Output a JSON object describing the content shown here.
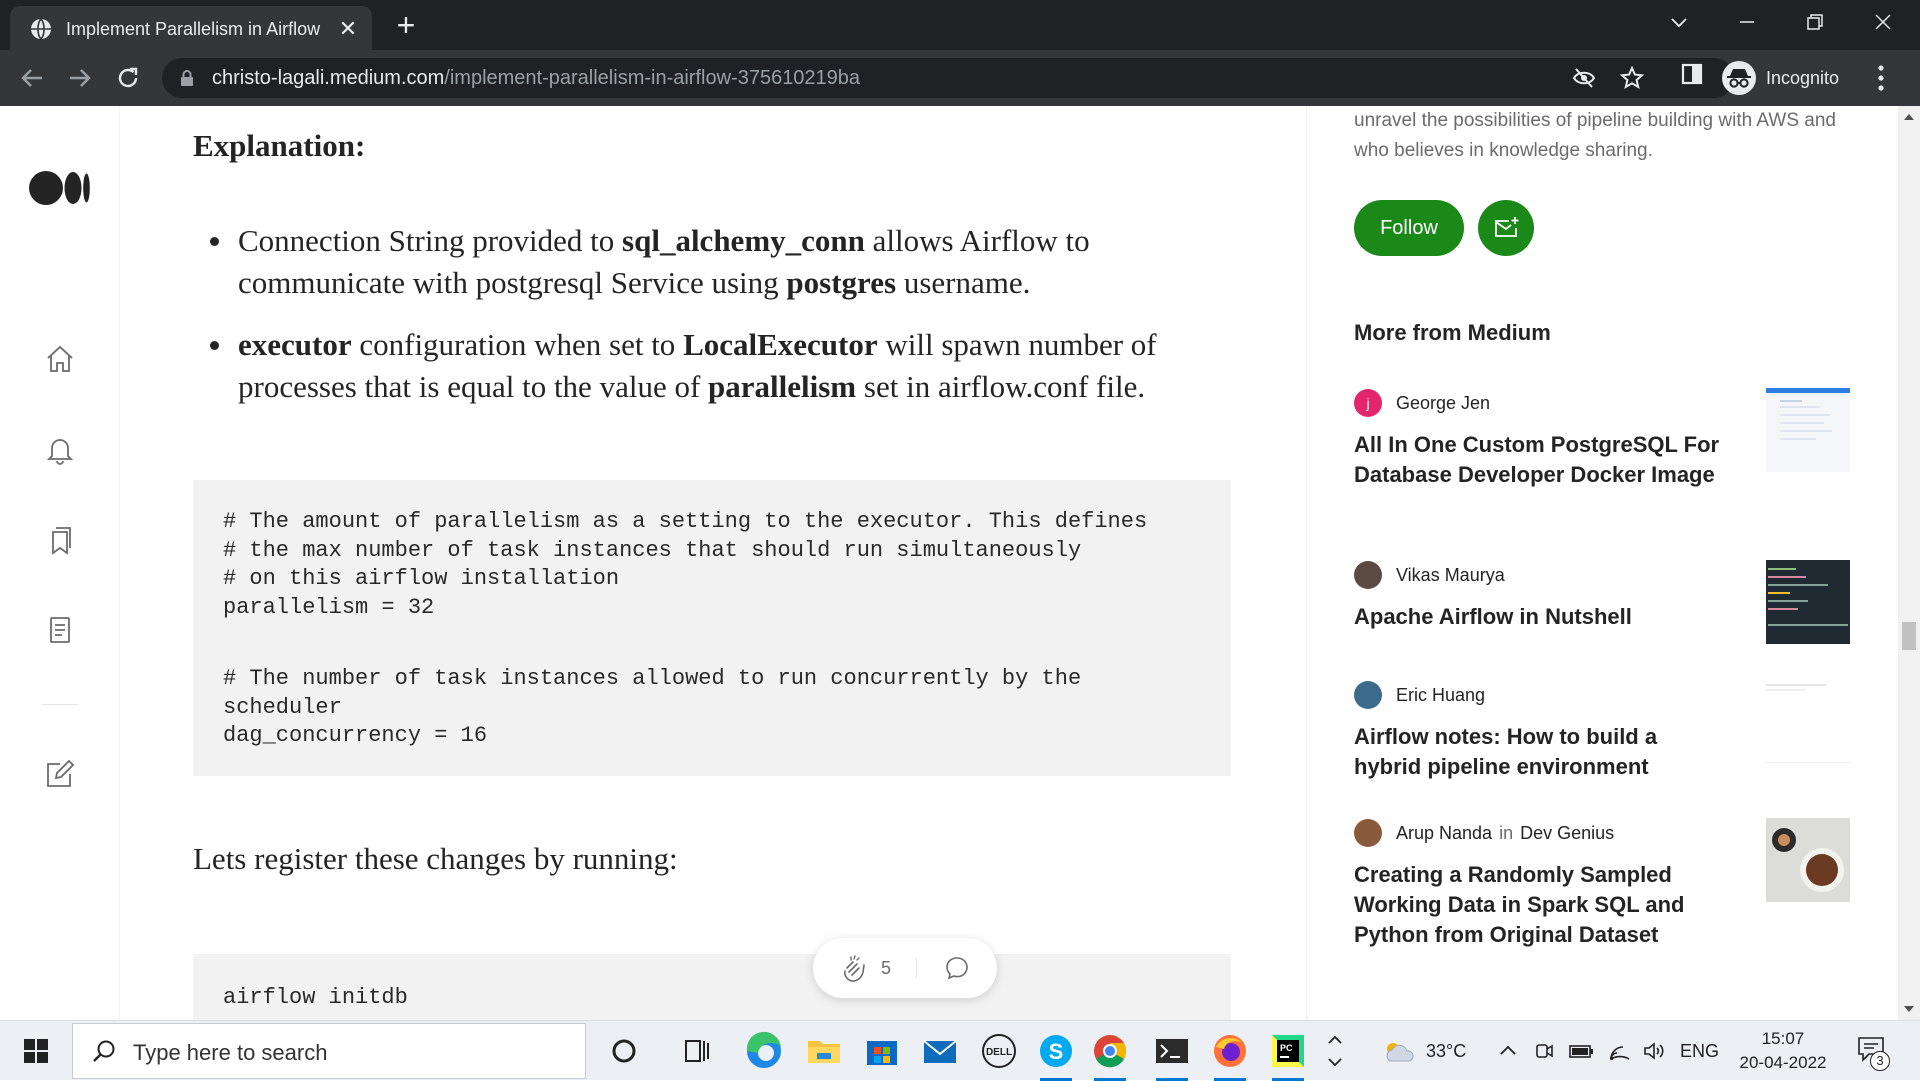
{
  "browser": {
    "tab_title": "Implement Parallelism in Airflow",
    "url_host": "christo-lagali.medium.com",
    "url_path": "/implement-parallelism-in-airflow-375610219ba",
    "profile_label": "Incognito"
  },
  "article": {
    "heading": "Explanation:",
    "bullets": [
      {
        "p1": "Connection String provided to ",
        "b1": "sql_alchemy_conn",
        "p2": " allows Airflow to communicate with postgresql Service using ",
        "b2": "postgres",
        "p3": " username."
      },
      {
        "b1": "executor",
        "p1": " configuration when set to ",
        "b2": "LocalExecutor",
        "p2": " will spawn number of processes that is equal to the value of ",
        "b3": "parallelism",
        "p3": " set in airflow.conf file."
      }
    ],
    "code1": {
      "l1": "# The amount of parallelism as a setting to the executor. This defines",
      "l2": "# the max number of task instances that should run simultaneously",
      "l3": "# on this airflow installation",
      "l4": "parallelism = 32",
      "l5": "# The number of task instances allowed to run concurrently by the",
      "l6": "scheduler",
      "l7": "dag_concurrency = 16"
    },
    "register_text": "Lets register these changes by running:",
    "code2": "airflow initdb",
    "clap_count": "5"
  },
  "sidebar": {
    "bio": "unravel the possibilities of pipeline building with AWS and who believes in knowledge sharing.",
    "follow_label": "Follow",
    "more_heading": "More from Medium",
    "stories": [
      {
        "author": "George Jen",
        "avatar_letter": "j",
        "title": "All In One Custom PostgreSQL For Database Developer Docker Image"
      },
      {
        "author": "Vikas Maurya",
        "title": "Apache Airflow in Nutshell"
      },
      {
        "author": "Eric Huang",
        "title": "Airflow notes: How to build a hybrid pipeline environment"
      },
      {
        "author": "Arup Nanda",
        "in": "in",
        "publication": "Dev Genius",
        "title": "Creating a Randomly Sampled Working Data in Spark SQL and Python from Original Dataset"
      }
    ]
  },
  "taskbar": {
    "search_placeholder": "Type here to search",
    "weather": "33°C",
    "language": "ENG",
    "time": "15:07",
    "date": "20-04-2022",
    "notification_count": "3"
  },
  "colors": {
    "medium_green": "#1a8917",
    "chrome_dark": "#202124",
    "chrome_toolbar": "#35363a"
  }
}
